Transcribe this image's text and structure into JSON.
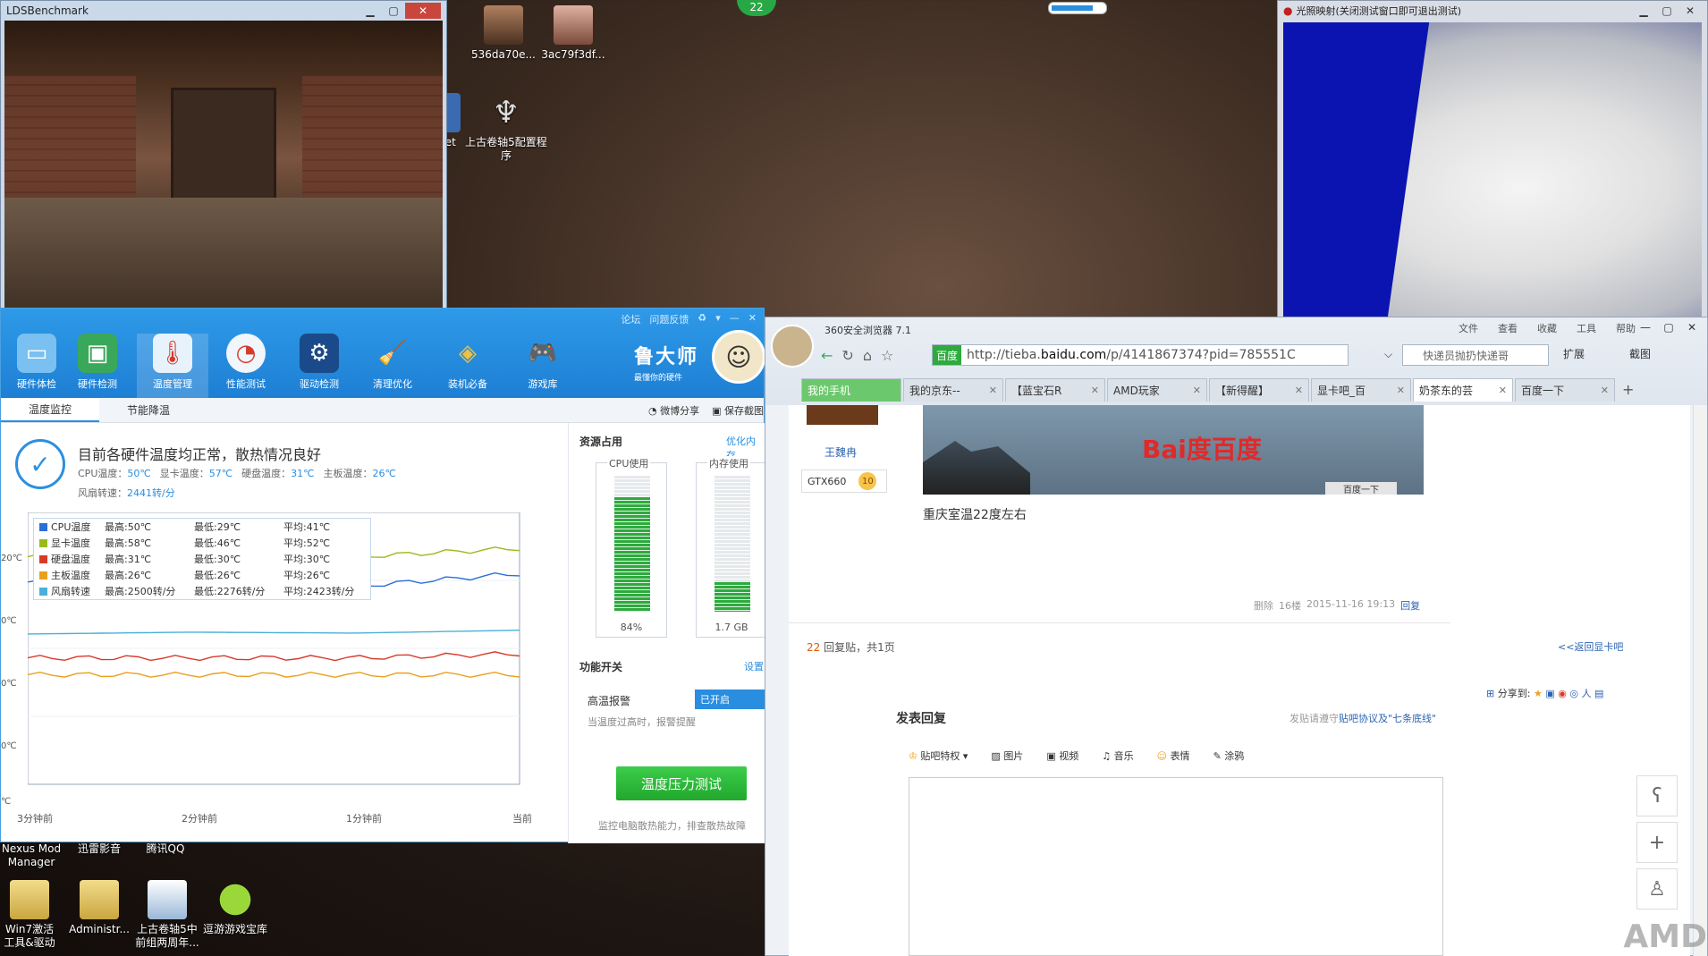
{
  "desktop": {
    "icons": [
      {
        "label": "536da70e...",
        "name": "desktop-icon-image-1"
      },
      {
        "label": "3ac79f3df...",
        "name": "desktop-icon-image-2"
      },
      {
        "label": "上古卷轴5配置程序",
        "name": "desktop-icon-skyrim-config"
      },
      {
        "label": "net",
        "name": "desktop-icon-net"
      },
      {
        "label": "Nexus Mod Manager",
        "name": "desktop-icon-nexus"
      },
      {
        "label": "迅雷影音",
        "name": "desktop-icon-xunlei"
      },
      {
        "label": "腾讯QQ",
        "name": "desktop-icon-qq"
      },
      {
        "label": "Win7激活工具&驱动",
        "name": "desktop-icon-win7"
      },
      {
        "label": "Administr...",
        "name": "desktop-icon-admin"
      },
      {
        "label": "上古卷轴5中前组两周年...",
        "name": "desktop-icon-skyrim"
      },
      {
        "label": "逗游游戏宝库",
        "name": "desktop-icon-douyou"
      }
    ],
    "badge": "22"
  },
  "lds": {
    "title": "LDSBenchmark"
  },
  "lightwin": {
    "title": "光照映射(关闭测试窗口即可退出测试)"
  },
  "lu": {
    "topbtns": [
      "论坛",
      "问题反馈"
    ],
    "tools": [
      "硬件体检",
      "硬件检测",
      "温度管理",
      "性能测试",
      "驱动检测",
      "清理优化",
      "装机必备",
      "游戏库"
    ],
    "brand": "鲁大师",
    "brand_sub": "最懂你的硬件",
    "tabs": [
      "温度监控",
      "节能降温"
    ],
    "share": "微博分享",
    "save": "保存截图",
    "status_title": "目前各硬件温度均正常，散热情况良好",
    "temps": [
      {
        "label": "CPU温度：",
        "value": "50℃"
      },
      {
        "label": "显卡温度：",
        "value": "57℃"
      },
      {
        "label": "硬盘温度：",
        "value": "31℃"
      },
      {
        "label": "主板温度：",
        "value": "26℃"
      }
    ],
    "fan_label": "风扇转速：",
    "fan_value": "2441转/分",
    "legend": [
      {
        "name": "CPU温度",
        "max": "最高:50℃",
        "min": "最低:29℃",
        "avg": "平均:41℃",
        "color": "#2a6fd8"
      },
      {
        "name": "显卡温度",
        "max": "最高:58℃",
        "min": "最低:46℃",
        "avg": "平均:52℃",
        "color": "#9aba1a"
      },
      {
        "name": "硬盘温度",
        "max": "最高:31℃",
        "min": "最低:30℃",
        "avg": "平均:30℃",
        "color": "#d83a2a"
      },
      {
        "name": "主板温度",
        "max": "最高:26℃",
        "min": "最低:26℃",
        "avg": "平均:26℃",
        "color": "#e8a020"
      },
      {
        "name": "风扇转速",
        "max": "最高:2500转/分",
        "min": "最低:2276转/分",
        "avg": "平均:2423转/分",
        "color": "#4ab0d8"
      }
    ],
    "xlabels": [
      "3分钟前",
      "2分钟前",
      "1分钟前",
      "当前"
    ],
    "ylabels": [
      "20℃",
      "0℃",
      "0℃",
      "0℃",
      "℃"
    ],
    "res_title": "资源占用",
    "res_link": "优化内存",
    "cpu_label": "CPU使用",
    "cpu_value": "84%",
    "cpu_fill": 0.84,
    "mem_label": "内存使用",
    "mem_value": "1.7 GB",
    "mem_fill": 0.22,
    "func_title": "功能开关",
    "func_link": "设置",
    "alarm_label": "高温报警",
    "alarm_state": "已开启",
    "alarm_sub": "当温度过高时，报警提醒",
    "stress_btn": "温度压力测试",
    "foot": "监控电脑散热能力，排查散热故障"
  },
  "chart_data": {
    "type": "line",
    "title": "",
    "x": [
      "3分钟前",
      "2分钟前",
      "1分钟前",
      "当前"
    ],
    "series": [
      {
        "name": "显卡温度",
        "values": [
          54,
          55,
          54,
          56
        ]
      },
      {
        "name": "CPU温度",
        "values": [
          48,
          46,
          47,
          50
        ]
      },
      {
        "name": "硬盘温度",
        "values": [
          30,
          30,
          30,
          31
        ]
      },
      {
        "name": "主板温度",
        "values": [
          26,
          26,
          26,
          26
        ]
      },
      {
        "name": "风扇转速",
        "values": [
          2400,
          2420,
          2410,
          2441
        ]
      }
    ]
  },
  "browser": {
    "title": "360安全浏览器 7.1",
    "menu": [
      "文件",
      "查看",
      "收藏",
      "工具",
      "帮助"
    ],
    "url_badge": "百度",
    "url_pre": "http://tieba.",
    "url_domain": "baidu.com",
    "url_post": "/p/4141867374?pid=785551C",
    "search": "快递员抛扔快递哥",
    "ext1": "扩展",
    "ext2": "截图",
    "tabs": [
      {
        "label": "我的手机",
        "style": "green"
      },
      {
        "label": "我的京东--",
        "style": ""
      },
      {
        "label": "【蓝宝石R",
        "style": ""
      },
      {
        "label": "AMD玩家",
        "style": ""
      },
      {
        "label": "【新得醒】",
        "style": ""
      },
      {
        "label": "显卡吧_百",
        "style": ""
      },
      {
        "label": "奶茶东的芸",
        "style": "on"
      },
      {
        "label": "百度一下",
        "style": ""
      }
    ],
    "user": "王魏冉",
    "user_badge": "GTX660",
    "user_level": "10",
    "img_button": "百度一下",
    "post_text": "重庆室温22度左右",
    "meta_del": "删除",
    "meta_floor": "16楼",
    "meta_time": "2015-11-16 19:13",
    "meta_reply": "回复",
    "count_num": "22",
    "count_text": "回复贴，共1页",
    "back_link": "<<返回显卡吧",
    "share_to": "分享到:",
    "reply_title": "发表回复",
    "agree_pre": "发贴请遵守",
    "agree_link": "贴吧协议及\"七条底线\"",
    "rtools": [
      "贴吧特权",
      "图片",
      "视频",
      "音乐",
      "表情",
      "涂鸦"
    ],
    "watermark": "AMD"
  }
}
